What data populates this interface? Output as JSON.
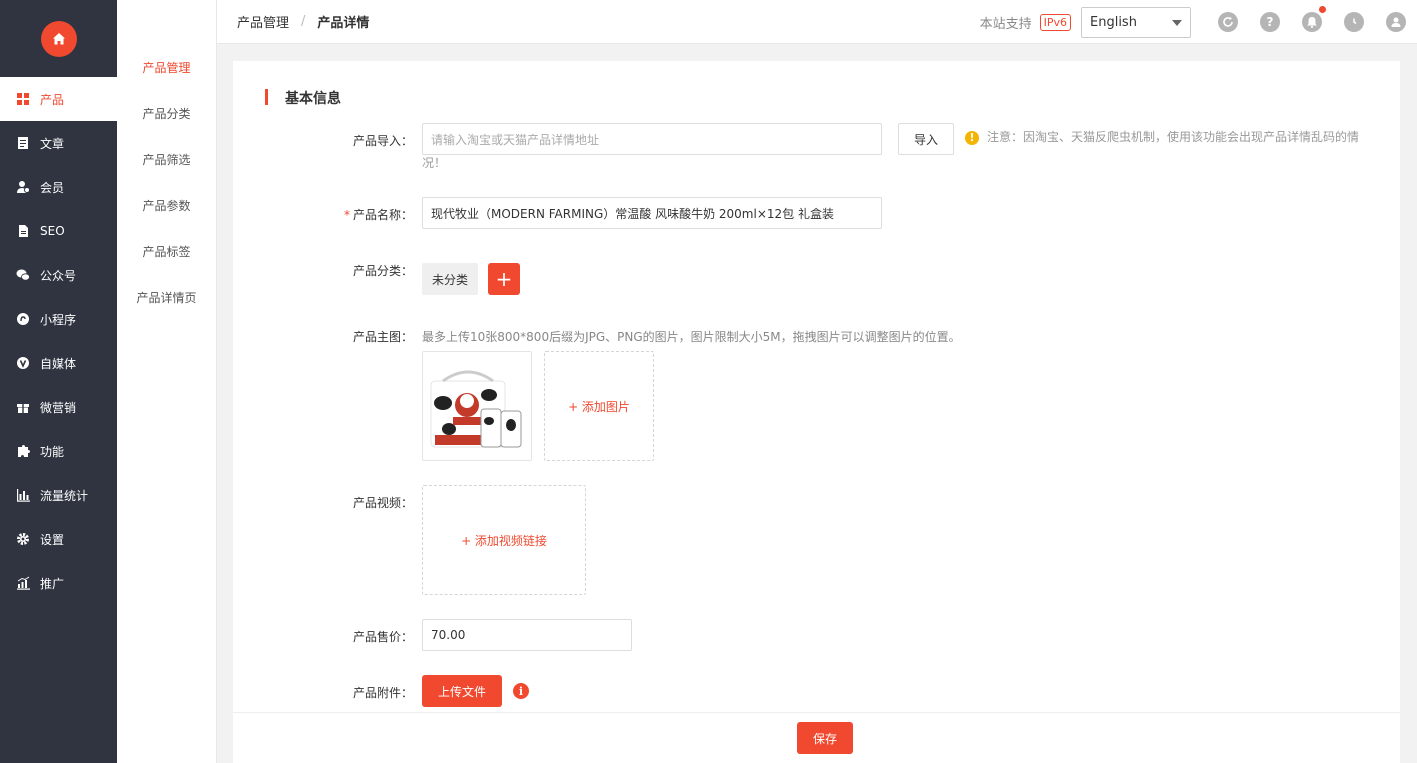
{
  "sidebar": {
    "items": [
      {
        "label": "产品",
        "icon": "grid-icon",
        "active": true
      },
      {
        "label": "文章",
        "icon": "document-icon"
      },
      {
        "label": "会员",
        "icon": "user-icon"
      },
      {
        "label": "SEO",
        "icon": "file-icon"
      },
      {
        "label": "公众号",
        "icon": "wechat-icon"
      },
      {
        "label": "小程序",
        "icon": "miniprogram-icon"
      },
      {
        "label": "自媒体",
        "icon": "v-icon"
      },
      {
        "label": "微营销",
        "icon": "gift-icon"
      },
      {
        "label": "功能",
        "icon": "puzzle-icon"
      },
      {
        "label": "流量统计",
        "icon": "bar-chart-icon"
      },
      {
        "label": "设置",
        "icon": "gear-icon"
      },
      {
        "label": "推广",
        "icon": "trend-icon"
      }
    ]
  },
  "subnav": {
    "items": [
      {
        "label": "产品管理",
        "active": true
      },
      {
        "label": "产品分类"
      },
      {
        "label": "产品筛选"
      },
      {
        "label": "产品参数"
      },
      {
        "label": "产品标签"
      },
      {
        "label": "产品详情页"
      }
    ]
  },
  "header": {
    "breadcrumb": [
      "产品管理",
      "产品详情"
    ],
    "support_label": "本站支持",
    "ipv6_badge": "IPv6",
    "language": "English"
  },
  "form": {
    "section_title": "基本信息",
    "import": {
      "label": "产品导入：",
      "placeholder": "请输入淘宝或天猫产品详情地址",
      "button": "导入",
      "note_line1": "注意：因淘宝、天猫反爬虫机制，使用该功能会出现产品详情乱码的情",
      "note_line2": "况！"
    },
    "name": {
      "required_mark": "*",
      "label": "产品名称：",
      "value": "现代牧业（MODERN FARMING）常温酸 风味酸牛奶 200ml×12包 礼盒装"
    },
    "category": {
      "label": "产品分类：",
      "tag": "未分类",
      "add_symbol": "+"
    },
    "main_image": {
      "label": "产品主图：",
      "hint": "最多上传10张800*800后缀为JPG、PNG的图片，图片限制大小5M，拖拽图片可以调整图片的位置。",
      "add_label": "+ 添加图片"
    },
    "video": {
      "label": "产品视频：",
      "add_label": "+ 添加视频链接"
    },
    "price": {
      "label": "产品售价：",
      "value": "70.00"
    },
    "attachment": {
      "label": "产品附件：",
      "button": "上传文件",
      "info_symbol": "i"
    },
    "save_button": "保存"
  },
  "colors": {
    "accent": "#f0492f",
    "sidebar_bg": "#2f3440",
    "warning": "#f5b400"
  }
}
